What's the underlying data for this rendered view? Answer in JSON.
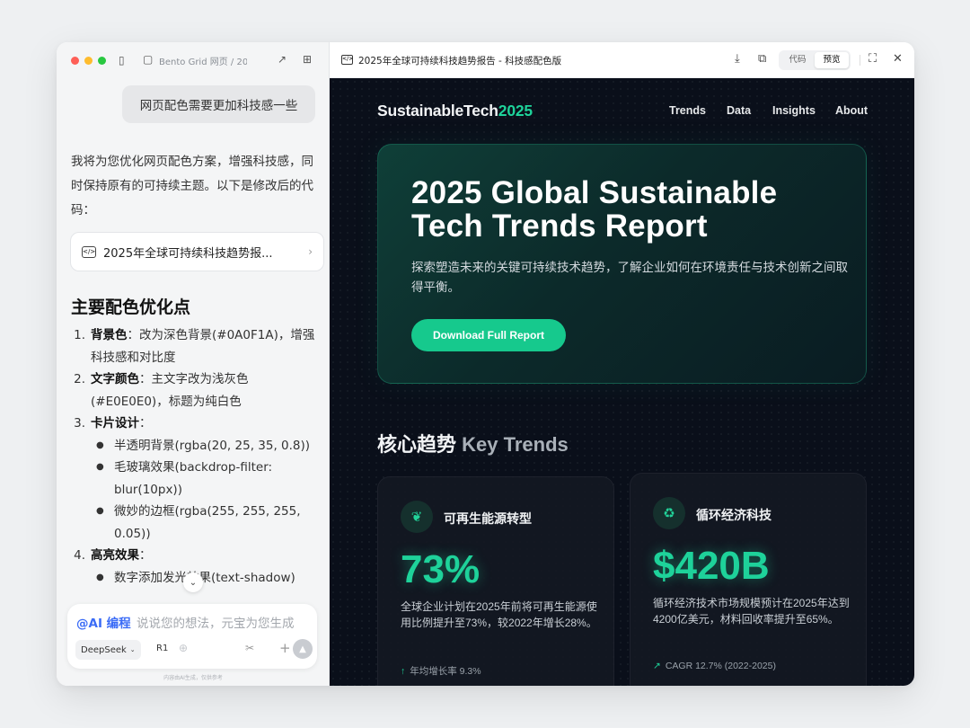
{
  "chat": {
    "header_title": "Bento Grid 网页 / 20",
    "user_message": "网页配色需要更加科技感一些",
    "intro": "我将为您优化网页配色方案，增强科技感，同时保持原有的可持续主题。以下是修改后的代码：",
    "artifact_label": "2025年全球可持续科技趋势报...",
    "section_heading": "主要配色优化点",
    "tips": {
      "t1_num": "1.",
      "t1_key": "背景色",
      "t1_text": "：改为深色背景(#0A0F1A)，增强科技感和对比度",
      "t2_num": "2.",
      "t2_key": "文字颜色",
      "t2_text": "：主文字改为浅灰色(#E0E0E0)，标题为纯白色",
      "t3_num": "3.",
      "t3_key": "卡片设计",
      "t3_text": "：",
      "t3_sub1": "半透明背景(rgba(20, 25, 35, 0.8))",
      "t3_sub2": "毛玻璃效果(backdrop-filter: blur(10px))",
      "t3_sub3": "微妙的边框(rgba(255, 255, 255, 0.05))",
      "t4_num": "4.",
      "t4_key": "高亮效果",
      "t4_text": "：",
      "t4_sub1": "数字添加发光效果(text-shadow)"
    },
    "composer": {
      "tag": "@AI 编程",
      "placeholder": "说说您的想法，元宝为您生成",
      "model": "DeepSeek",
      "mode": "R1"
    },
    "disclaimer": "内容由AI生成，仅供参考"
  },
  "preview": {
    "title": "2025年全球可持续科技趋势报告 - 科技感配色版",
    "toggle_code": "代码",
    "toggle_preview": "预览",
    "toggle_active": "预览"
  },
  "site": {
    "logo_main": "SustainableTech",
    "logo_accent": "2025",
    "nav": [
      "Trends",
      "Data",
      "Insights",
      "About"
    ],
    "hero_title": "2025 Global Sustainable Tech Trends Report",
    "hero_subtitle": "探索塑造未来的关键可持续技术趋势，了解企业如何在环境责任与技术创新之间取得平衡。",
    "cta": "Download Full Report",
    "section_cn": "核心趋势",
    "section_en": "Key Trends",
    "cards": [
      {
        "icon": "leaf-icon",
        "title": "可再生能源转型",
        "stat": "73%",
        "desc": "全球企业计划在2025年前将可再生能源使用比例提升至73%，较2022年增长28%。",
        "meta": "年均增长率 9.3%"
      },
      {
        "icon": "recycle-icon",
        "title": "循环经济科技",
        "stat": "$420B",
        "desc": "循环经济技术市场规模预计在2025年达到4200亿美元，材料回收率提升至65%。",
        "meta": "CAGR 12.7% (2022-2025)"
      }
    ],
    "colors": {
      "background": "#0a0f1a",
      "accent": "#1ed29a",
      "button": "#16c98d"
    }
  }
}
